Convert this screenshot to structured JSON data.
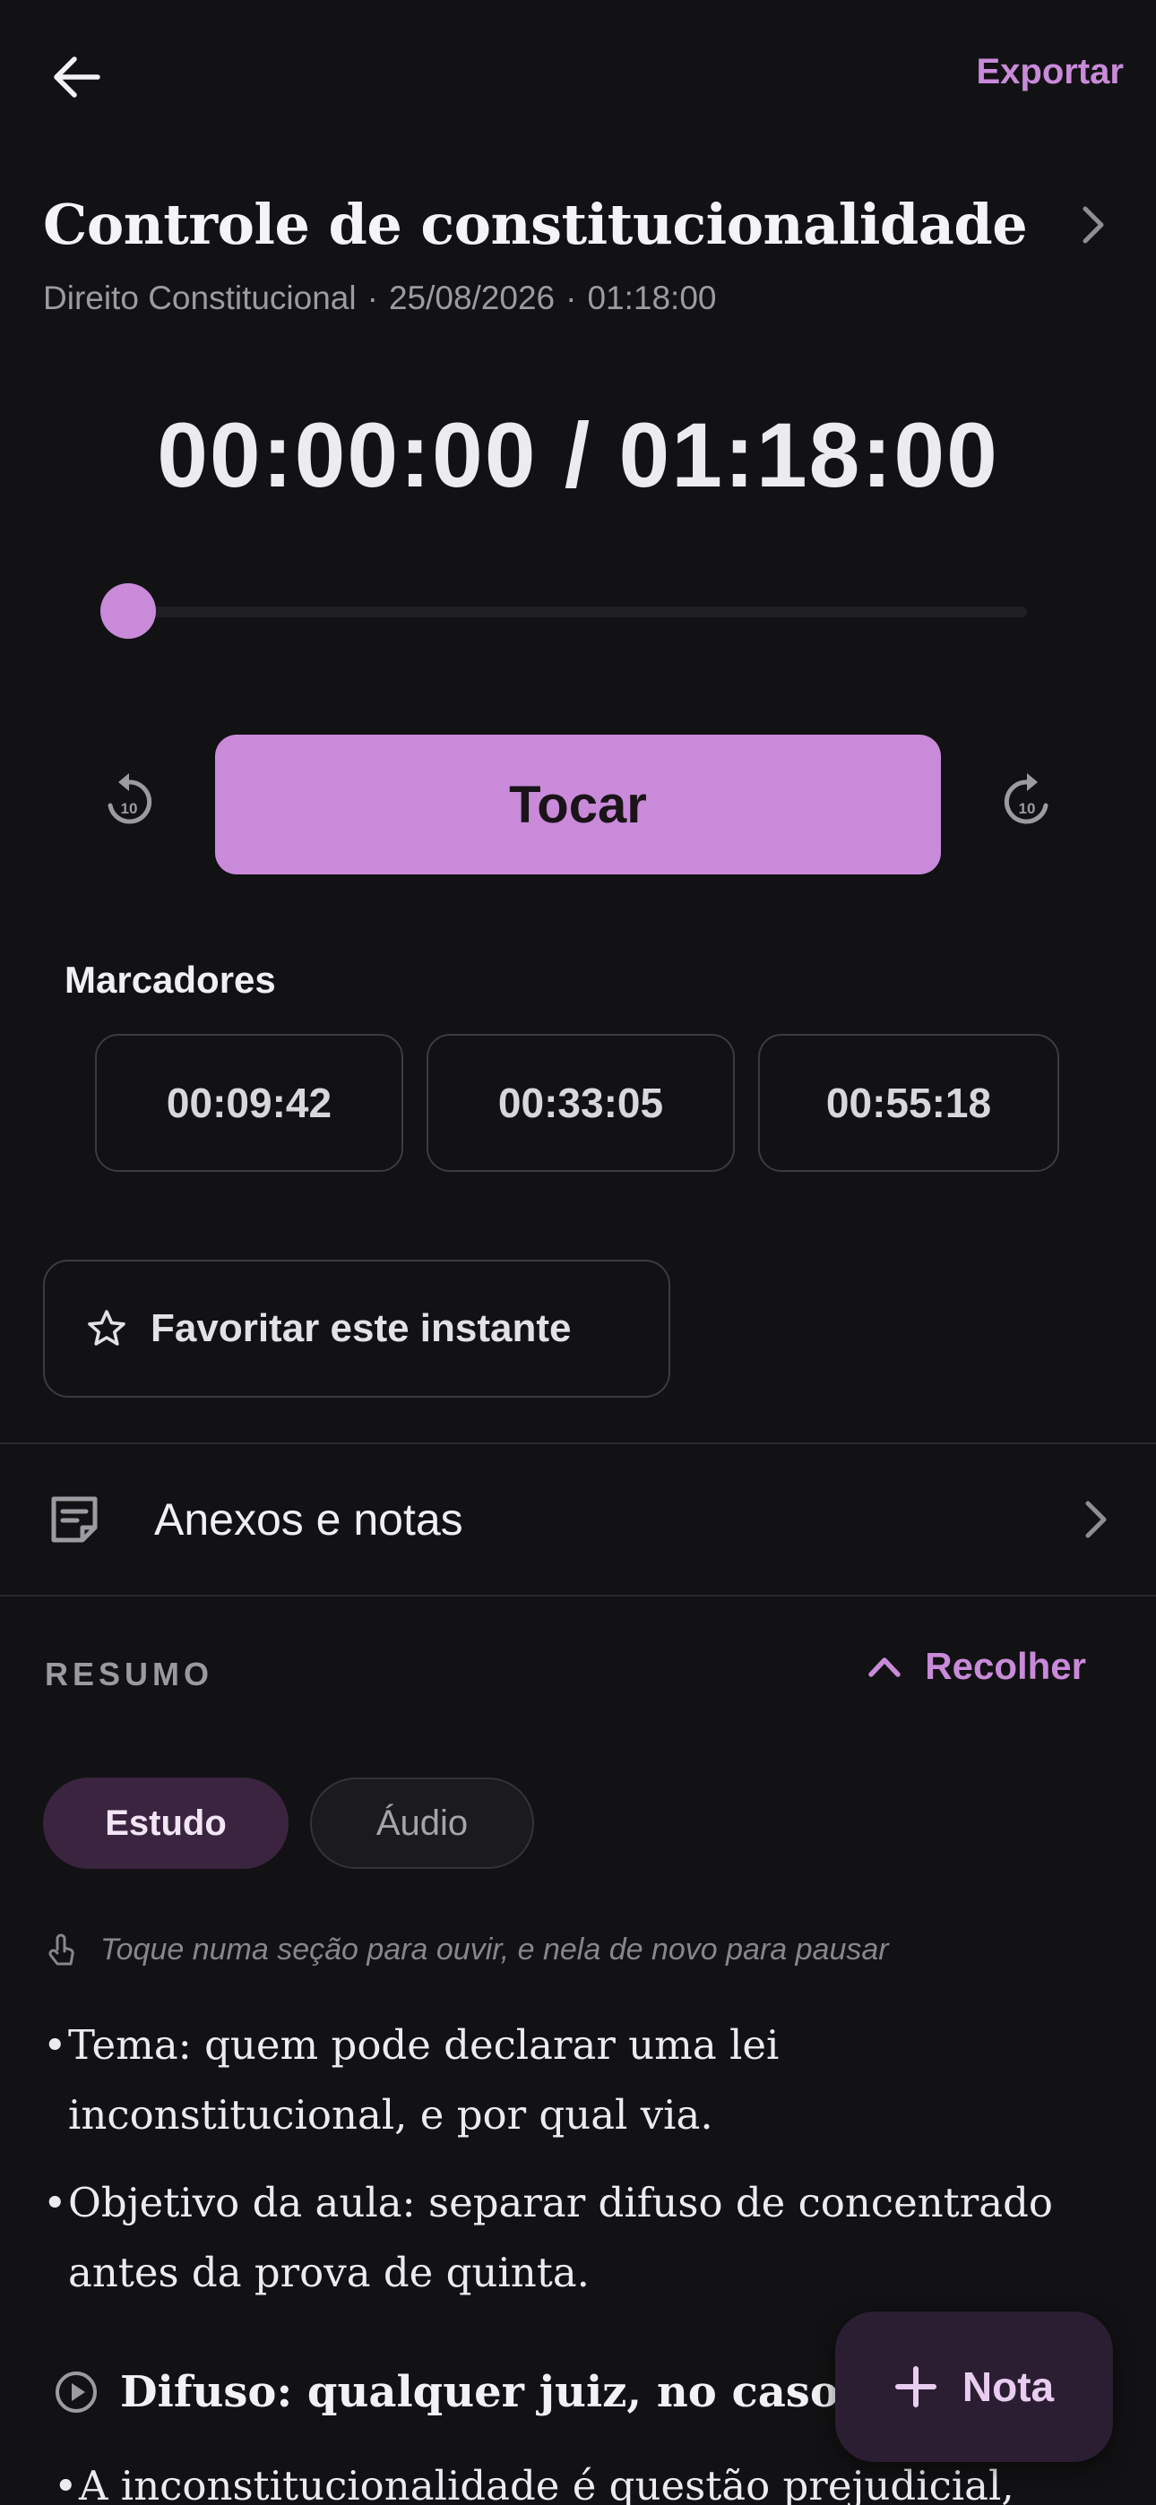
{
  "header": {
    "export_label": "Exportar"
  },
  "lesson": {
    "title": "Controle de constitucionalidade",
    "subject": "Direito Constitucional",
    "date": "25/08/2026",
    "duration": "01:18:00",
    "separator": "·"
  },
  "player": {
    "time_display": "00:00:00 / 01:18:00",
    "progress_fraction": 0,
    "play_label": "Tocar",
    "skip_seconds": "10"
  },
  "markers": {
    "label": "Marcadores",
    "items": [
      "00:09:42",
      "00:33:05",
      "00:55:18"
    ]
  },
  "favorite": {
    "label": "Favoritar este instante"
  },
  "attachments": {
    "label": "Anexos e notas"
  },
  "summary": {
    "section_label": "RESUMO",
    "collapse_label": "Recolher",
    "tabs": [
      {
        "label": "Estudo",
        "selected": true
      },
      {
        "label": "Áudio",
        "selected": false
      }
    ],
    "hint": "Toque numa seção para ouvir, e nela de novo para pausar",
    "bullets": [
      {
        "line1": "Tema: quem pode declarar uma lei",
        "line2": "inconstitucional, e por qual via."
      },
      {
        "line1": "Objetivo da aula: separar difuso de concentrado",
        "line2": "antes da prova de quinta."
      }
    ],
    "section_title": "Difuso: qualquer juiz, no caso c",
    "section_bullet": "A inconstitucionalidade é questão prejudicial,"
  },
  "fab": {
    "label": "Nota"
  },
  "colors": {
    "accent": "#c98ad9",
    "background": "#121214"
  }
}
